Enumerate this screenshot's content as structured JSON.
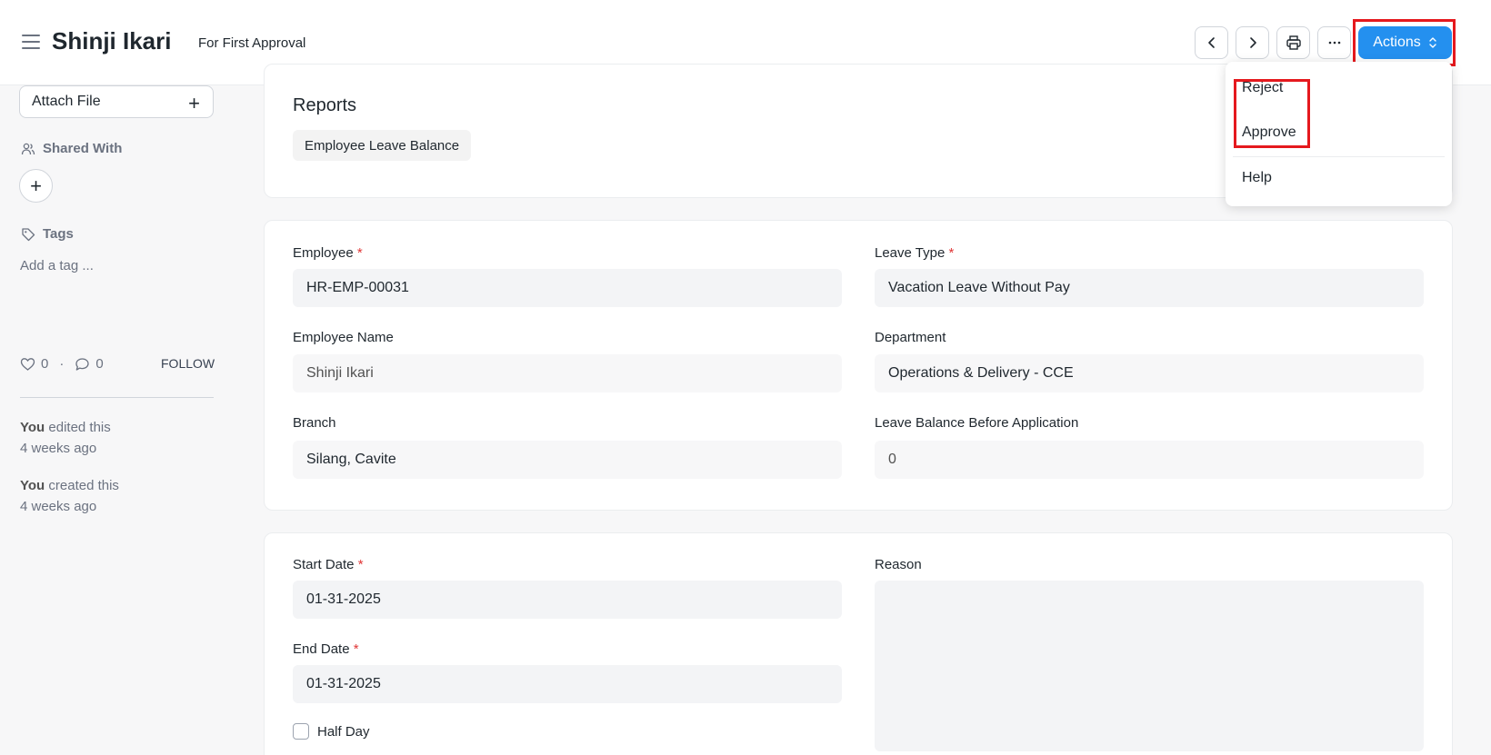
{
  "header": {
    "title": "Shinji Ikari",
    "status": "For First Approval",
    "actions_label": "Actions"
  },
  "actions_menu": {
    "items": [
      "Reject",
      "Approve",
      "Help"
    ]
  },
  "sidebar": {
    "attach_label": "Attach File",
    "shared_with_label": "Shared With",
    "tags_label": "Tags",
    "add_tag_placeholder": "Add a tag ...",
    "likes_count": "0",
    "comments_count": "0",
    "dot_separator": "·",
    "follow_label": "FOLLOW",
    "activity": [
      {
        "user": "You",
        "action": "edited this",
        "time": "4 weeks ago"
      },
      {
        "user": "You",
        "action": "created this",
        "time": "4 weeks ago"
      }
    ]
  },
  "reports": {
    "title": "Reports",
    "chips": [
      "Employee Leave Balance"
    ]
  },
  "employee_section": {
    "employee": {
      "label": "Employee",
      "required": "*",
      "value": "HR-EMP-00031"
    },
    "leave_type": {
      "label": "Leave Type",
      "required": "*",
      "value": "Vacation Leave Without Pay"
    },
    "employee_name": {
      "label": "Employee Name",
      "value": "Shinji Ikari"
    },
    "department": {
      "label": "Department",
      "value": "Operations & Delivery - CCE"
    },
    "branch": {
      "label": "Branch",
      "value": "Silang, Cavite"
    },
    "leave_balance": {
      "label": "Leave Balance Before Application",
      "value": "0"
    }
  },
  "date_section": {
    "start_date": {
      "label": "Start Date",
      "required": "*",
      "value": "01-31-2025"
    },
    "end_date": {
      "label": "End Date",
      "required": "*",
      "value": "01-31-2025"
    },
    "half_day_label": "Half Day",
    "reason_label": "Reason"
  },
  "colors": {
    "primary": "#2490ef",
    "highlight": "#e5191e",
    "required": "#e03636"
  }
}
